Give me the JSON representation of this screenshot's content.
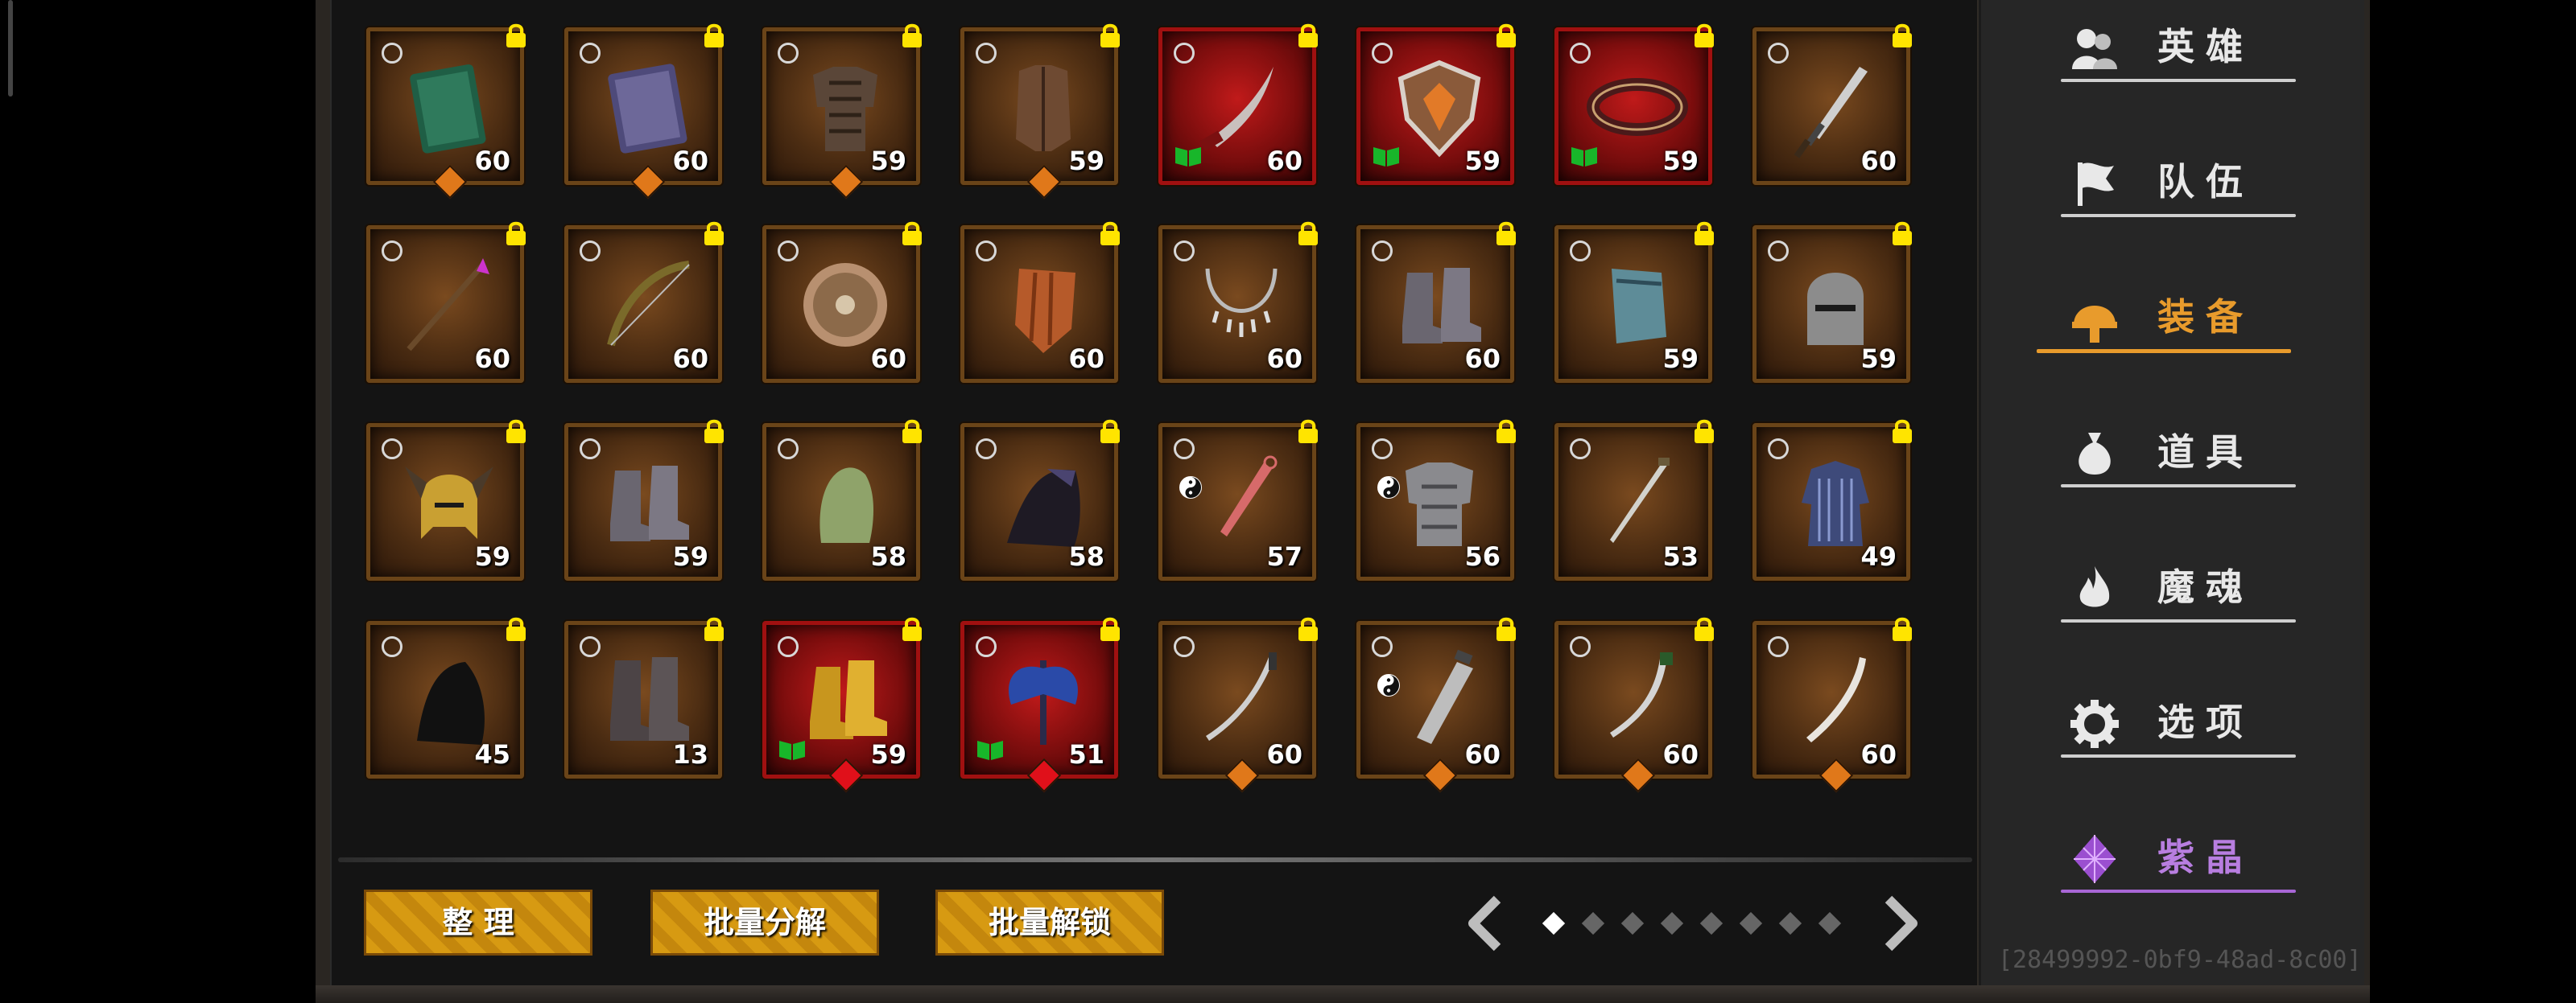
{
  "colors": {
    "accent": "#e89b2c",
    "special": "#a866d6",
    "rare_bg": "#b01515",
    "lock": "#ffe400",
    "book": "#18b62a"
  },
  "inventory": {
    "items": [
      {
        "icon": "green-book-icon",
        "level": "60",
        "rare": false,
        "gem": "orange"
      },
      {
        "icon": "purple-book-icon",
        "level": "60",
        "rare": false,
        "gem": "orange"
      },
      {
        "icon": "leather-armor-icon",
        "level": "59",
        "rare": false,
        "gem": "orange"
      },
      {
        "icon": "leather-vest-icon",
        "level": "59",
        "rare": false,
        "gem": "orange"
      },
      {
        "icon": "curved-dagger-icon",
        "level": "60",
        "rare": true,
        "book": true
      },
      {
        "icon": "ornate-shield-icon",
        "level": "59",
        "rare": true,
        "book": true
      },
      {
        "icon": "belt-icon",
        "level": "59",
        "rare": true,
        "book": true
      },
      {
        "icon": "short-sword-icon",
        "level": "60",
        "rare": false
      },
      {
        "icon": "spear-icon",
        "level": "60",
        "rare": false
      },
      {
        "icon": "bow-icon",
        "level": "60",
        "rare": false
      },
      {
        "icon": "round-shield-icon",
        "level": "60",
        "rare": false
      },
      {
        "icon": "kite-shield-icon",
        "level": "60",
        "rare": false
      },
      {
        "icon": "necklace-icon",
        "level": "60",
        "rare": false
      },
      {
        "icon": "boots-icon",
        "level": "60",
        "rare": false
      },
      {
        "icon": "bracer-icon",
        "level": "59",
        "rare": false
      },
      {
        "icon": "knight-helmet-icon",
        "level": "59",
        "rare": false
      },
      {
        "icon": "horned-helmet-icon",
        "level": "59",
        "rare": false
      },
      {
        "icon": "boots-icon",
        "level": "59",
        "rare": false
      },
      {
        "icon": "green-hood-icon",
        "level": "58",
        "rare": false
      },
      {
        "icon": "dark-cloak-icon",
        "level": "58",
        "rare": false
      },
      {
        "icon": "red-dagger-icon",
        "level": "57",
        "rare": false,
        "yin": true
      },
      {
        "icon": "plate-armor-icon",
        "level": "56",
        "rare": false,
        "yin": true
      },
      {
        "icon": "thin-blade-icon",
        "level": "53",
        "rare": false
      },
      {
        "icon": "blue-robe-icon",
        "level": "49",
        "rare": false
      },
      {
        "icon": "black-cloak-icon",
        "level": "45",
        "rare": false
      },
      {
        "icon": "tall-boots-icon",
        "level": "13",
        "rare": false
      },
      {
        "icon": "golden-boots-icon",
        "level": "59",
        "rare": true,
        "book": true,
        "gem": "red"
      },
      {
        "icon": "battle-axe-icon",
        "level": "51",
        "rare": true,
        "book": true,
        "gem": "red"
      },
      {
        "icon": "scimitar-icon",
        "level": "60",
        "rare": false,
        "gem": "orange"
      },
      {
        "icon": "cleaver-icon",
        "level": "60",
        "rare": false,
        "yin": true,
        "gem": "orange"
      },
      {
        "icon": "curved-knife-icon",
        "level": "60",
        "rare": false,
        "gem": "orange"
      },
      {
        "icon": "bone-blade-icon",
        "level": "60",
        "rare": false,
        "gem": "orange"
      }
    ]
  },
  "actions": {
    "sort": "整 理",
    "batch_decompose": "批量分解",
    "batch_unlock": "批量解锁"
  },
  "pager": {
    "total_pages": 8,
    "current_page": 1
  },
  "sidebar": {
    "items": [
      {
        "key": "hero",
        "label": "英雄",
        "icon": "heroes-icon"
      },
      {
        "key": "team",
        "label": "队伍",
        "icon": "flag-icon"
      },
      {
        "key": "equipment",
        "label": "装备",
        "icon": "helmet-icon",
        "active": true
      },
      {
        "key": "items",
        "label": "道具",
        "icon": "bag-icon"
      },
      {
        "key": "soul",
        "label": "魔魂",
        "icon": "flame-icon"
      },
      {
        "key": "options",
        "label": "选项",
        "icon": "gear-icon"
      },
      {
        "key": "crystal",
        "label": "紫晶",
        "icon": "crystal-icon",
        "special": true
      }
    ]
  },
  "footer": {
    "build_id": "[28499992-0bf9-48ad-8c00]"
  }
}
